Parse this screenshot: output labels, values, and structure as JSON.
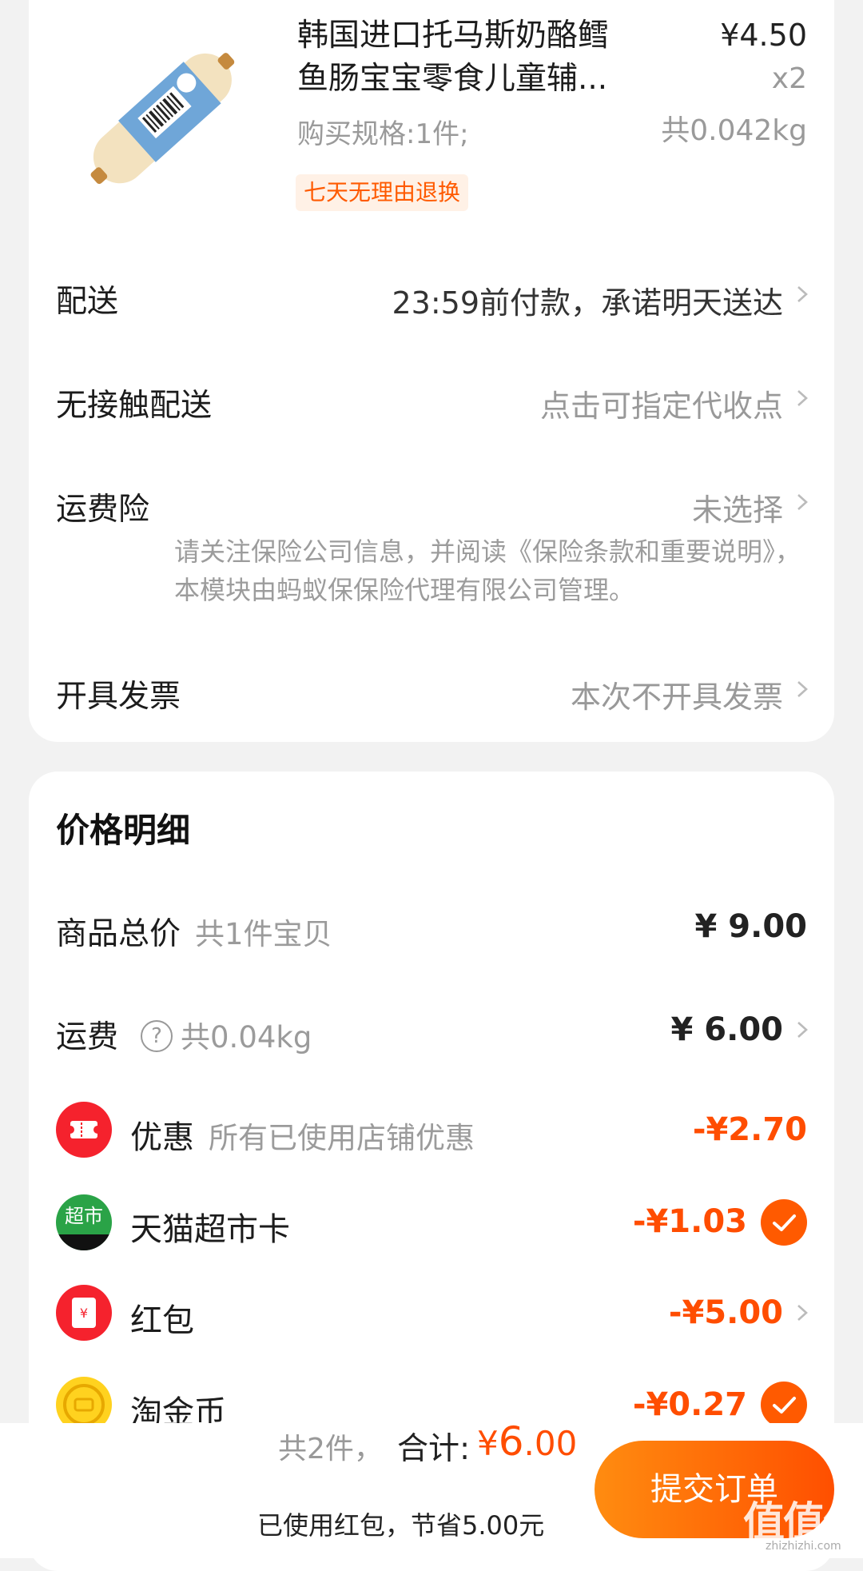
{
  "product": {
    "title": "韩国进口托马斯奶酪鳕鱼肠宝宝零食儿童辅...",
    "price": "¥4.50",
    "quantity": "x2",
    "weight": "共0.042kg",
    "spec": "购买规格:1件;",
    "tag": "七天无理由退换"
  },
  "rows": {
    "delivery": {
      "label": "配送",
      "value": "23:59前付款，承诺明天送达"
    },
    "contactless": {
      "label": "无接触配送",
      "value": "点击可指定代收点"
    },
    "insurance": {
      "label": "运费险",
      "value": "未选择",
      "notice": "请关注保险公司信息，并阅读《保险条款和重要说明》，本模块由蚂蚁保保险代理有限公司管理。"
    },
    "invoice": {
      "label": "开具发票",
      "value": "本次不开具发票"
    }
  },
  "price_detail": {
    "title": "价格明细",
    "goods_total": {
      "label": "商品总价",
      "sub": "共1件宝贝",
      "amount": "¥ 9.00"
    },
    "shipping": {
      "label": "运费",
      "qmark": "?",
      "sub": "共0.04kg",
      "amount": "¥ 6.00"
    },
    "discount": {
      "label": "优惠",
      "sub": "所有已使用店铺优惠",
      "amount": "-¥2.70"
    },
    "tmall_card": {
      "label": "天猫超市卡",
      "icon_text": "超市",
      "amount": "-¥1.03"
    },
    "red_packet": {
      "label": "红包",
      "icon_text": "¥",
      "amount": "-¥5.00"
    },
    "gold_coin": {
      "label": "淘金币",
      "amount": "-¥0.27"
    }
  },
  "bottom_bar": {
    "count": "共2件，",
    "total_label": "合计:",
    "currency": "¥",
    "total_int": "6",
    "total_dec": ".00",
    "saved": "已使用红包，节省5.00元",
    "submit": "提交订单",
    "watermark": "值值值",
    "watermark_url": "zhizhizhi.com"
  },
  "colors": {
    "accent": "#ff5a00",
    "price_orange": "#ff4d00",
    "background": "#f2f2f2"
  }
}
